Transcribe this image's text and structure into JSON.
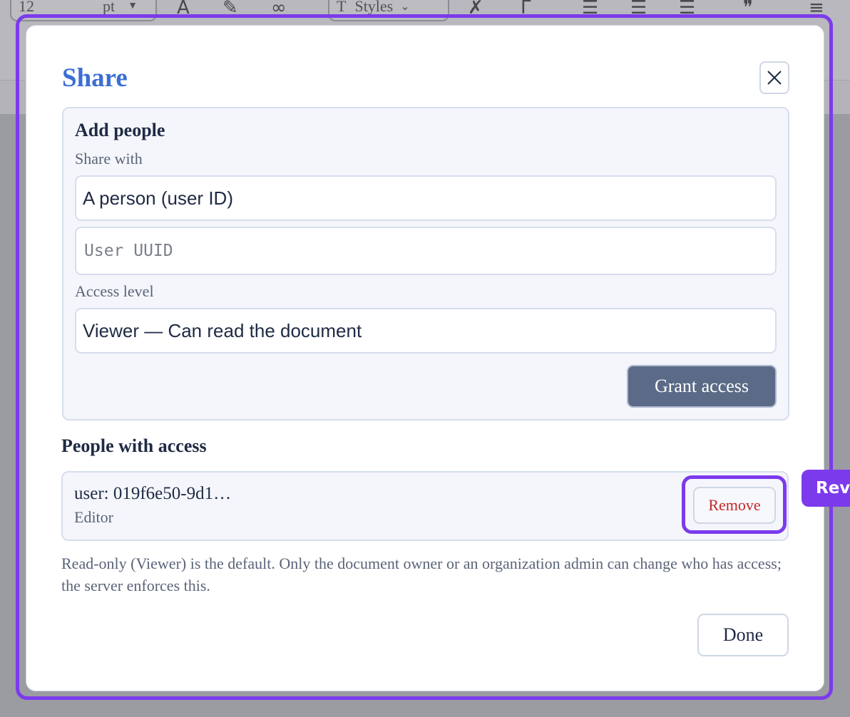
{
  "toolbar": {
    "font_size": "12",
    "font_unit": "pt",
    "styles_label": "Styles"
  },
  "dialog": {
    "title": "Share",
    "add_section_title": "Add people",
    "share_with_label": "Share with",
    "share_with_value": "A person (user ID)",
    "uuid_placeholder": "User UUID",
    "access_level_label": "Access level",
    "access_level_value": "Viewer — Can read the document",
    "grant_label": "Grant access",
    "people_title": "People with access",
    "people": [
      {
        "user": "user: 019f6e50-9d1…",
        "role": "Editor",
        "remove_label": "Remove"
      }
    ],
    "footnote": "Read-only (Viewer) is the default. Only the document owner or an organization admin can change who has access; the server enforces this.",
    "done_label": "Done"
  },
  "hint": {
    "label": "Revo"
  },
  "colors": {
    "accent": "#3b6fd4",
    "highlight": "#7c3aed",
    "primary_button": "#5b6b87",
    "danger_text": "#c62828"
  },
  "icons": [
    "close-icon",
    "font-color-icon",
    "highlighter-icon",
    "link-icon",
    "clear-format-icon",
    "bullet-list-icon",
    "numbered-list-icon",
    "quote-icon",
    "align-left-icon"
  ]
}
